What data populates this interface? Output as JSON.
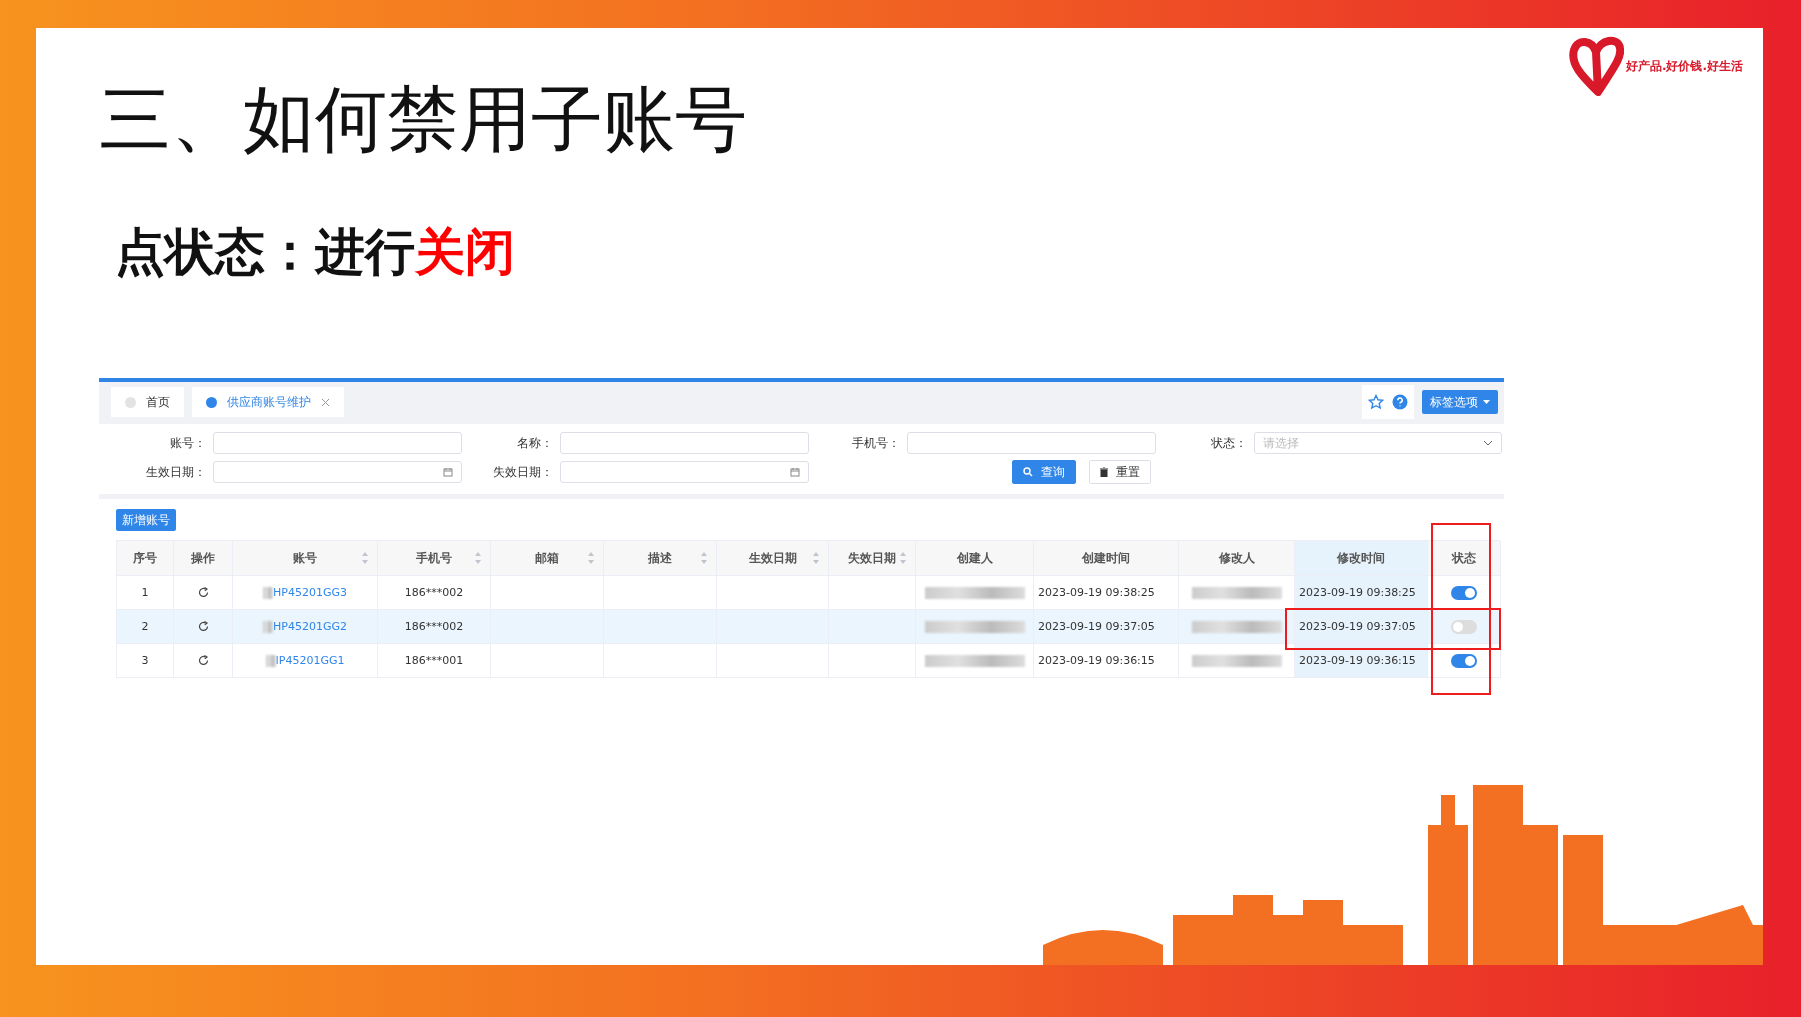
{
  "slide": {
    "title": "三、如何禁用子账号",
    "subtitle": [
      {
        "text": "点状态：进行",
        "kind": "plain"
      },
      {
        "text": "关闭",
        "kind": "highlight"
      }
    ],
    "logo_text": "好产品.好价钱.好生活"
  },
  "app": {
    "tabs": [
      {
        "label": "首页",
        "selected": false,
        "closable": false
      },
      {
        "label": "供应商账号维护",
        "selected": true,
        "closable": true
      }
    ],
    "tab_options": "标签选项",
    "form": {
      "fields": [
        {
          "label": "账号：",
          "kind": "text"
        },
        {
          "label": "名称：",
          "kind": "text"
        },
        {
          "label": "手机号：",
          "kind": "text"
        },
        {
          "label": "状态：",
          "kind": "select",
          "placeholder": "请选择"
        },
        {
          "label": "生效日期：",
          "kind": "date"
        },
        {
          "label": "失效日期：",
          "kind": "date"
        }
      ],
      "buttons": [
        {
          "label": "查询",
          "kind": "primary"
        },
        {
          "label": "重置",
          "kind": "default"
        }
      ]
    },
    "add_button": "新增账号",
    "table": {
      "columns": [
        {
          "label": "序号",
          "sortable": false,
          "highlighted": false
        },
        {
          "label": "操作",
          "sortable": false,
          "highlighted": false
        },
        {
          "label": "账号",
          "sortable": true,
          "highlighted": false
        },
        {
          "label": "手机号",
          "sortable": true,
          "highlighted": false
        },
        {
          "label": "邮箱",
          "sortable": true,
          "highlighted": false
        },
        {
          "label": "描述",
          "sortable": true,
          "highlighted": false
        },
        {
          "label": "生效日期",
          "sortable": true,
          "highlighted": false
        },
        {
          "label": "失效日期",
          "sortable": true,
          "highlighted": false
        },
        {
          "label": "创建人",
          "sortable": false,
          "highlighted": false
        },
        {
          "label": "创建时间",
          "sortable": false,
          "highlighted": false
        },
        {
          "label": "修改人",
          "sortable": false,
          "highlighted": false
        },
        {
          "label": "修改时间",
          "sortable": false,
          "highlighted": true
        },
        {
          "label": "状态",
          "sortable": false,
          "highlighted": false
        }
      ],
      "rows": [
        {
          "index": "1",
          "account": "HP45201GG3",
          "phone": "186***002",
          "created": "2023-09-19 09:38:25",
          "modified": "2023-09-19 09:38:25",
          "status_on": true,
          "selected": false
        },
        {
          "index": "2",
          "account": "HP45201GG2",
          "phone": "186***002",
          "created": "2023-09-19 09:37:05",
          "modified": "2023-09-19 09:37:05",
          "status_on": false,
          "selected": true
        },
        {
          "index": "3",
          "account": "IP45201GG1",
          "phone": "186***001",
          "created": "2023-09-19 09:36:15",
          "modified": "2023-09-19 09:36:15",
          "status_on": true,
          "selected": false
        }
      ]
    }
  }
}
